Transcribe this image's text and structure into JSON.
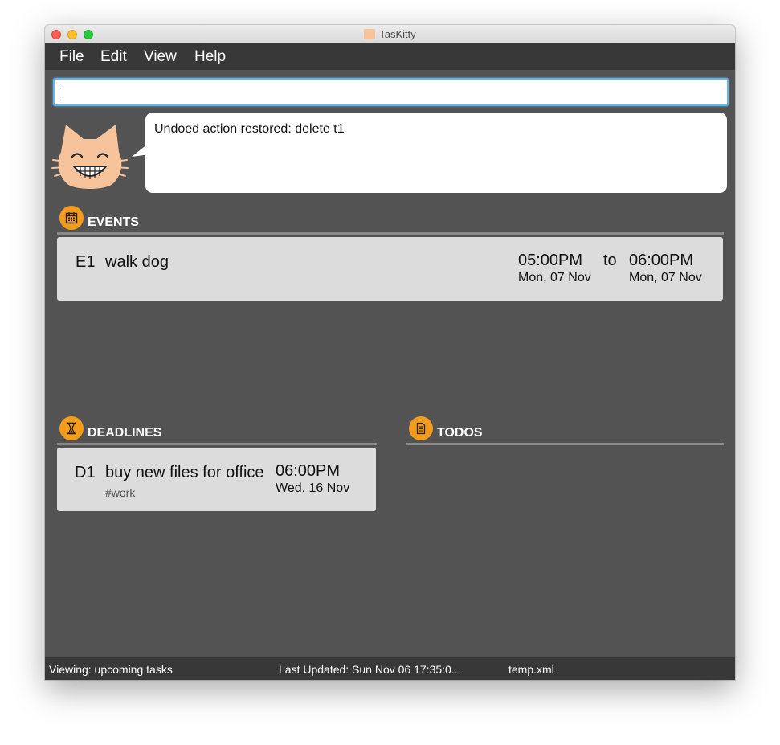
{
  "window": {
    "title": "TasKitty"
  },
  "menu": {
    "items": [
      "File",
      "Edit",
      "View",
      "Help"
    ]
  },
  "command": {
    "value": ""
  },
  "message": {
    "text": "Undoed action restored: delete t1"
  },
  "events": {
    "title": "EVENTS",
    "items": [
      {
        "id": "E1",
        "name": "walk dog",
        "start_time": "05:00PM",
        "start_date": "Mon, 07 Nov",
        "separator": "to",
        "end_time": "06:00PM",
        "end_date": "Mon, 07 Nov"
      }
    ]
  },
  "deadlines": {
    "title": "DEADLINES",
    "items": [
      {
        "id": "D1",
        "name": "buy new files for office",
        "tag": "#work",
        "time": "06:00PM",
        "date": "Wed, 16 Nov"
      }
    ]
  },
  "todos": {
    "title": "TODOS",
    "items": []
  },
  "status": {
    "viewing": "Viewing: upcoming tasks",
    "last_updated": "Last Updated: Sun Nov 06 17:35:0...",
    "file": "temp.xml"
  },
  "colors": {
    "accent": "#f39c1e",
    "background": "#535353",
    "bar": "#383838",
    "card": "#dcdcdc",
    "cat": "#f6c39b",
    "focus": "#5fb6e8"
  },
  "icons": {
    "events": "calendar-icon",
    "deadlines": "hourglass-icon",
    "todos": "document-icon",
    "mascot": "cat-icon"
  }
}
